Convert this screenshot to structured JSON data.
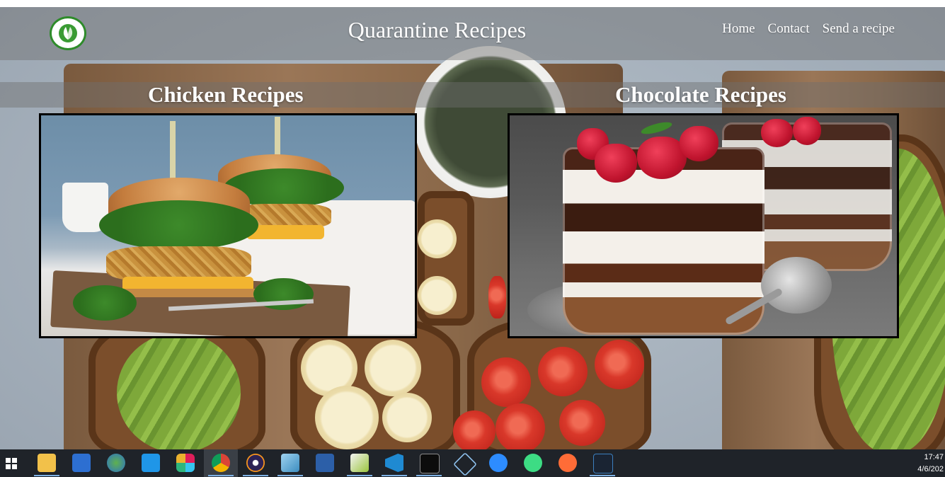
{
  "site": {
    "title": "Quarantine Recipes",
    "nav": [
      "Home",
      "Contact",
      "Send a recipe"
    ]
  },
  "sections": [
    {
      "title": "Chicken Recipes"
    },
    {
      "title": "Chocolate Recipes"
    }
  ],
  "taskbar": {
    "apps": [
      "windows-start-icon",
      "file-explorer-icon",
      "security-app-icon",
      "globe-browser-icon",
      "teamviewer-icon",
      "slack-icon",
      "chrome-icon",
      "eclipse-icon",
      "notepad-icon",
      "network-app-icon",
      "spreadsheet-icon",
      "vscode-icon",
      "terminal-icon",
      "box-app-icon",
      "zoom-icon",
      "android-studio-icon",
      "postman-icon",
      "nox-icon"
    ],
    "time": "17:47",
    "date": "4/6/202"
  },
  "colors": {
    "overlay": "#6e6e6e",
    "logo_green": "#2e8b2a",
    "taskbar": "#1f2329"
  }
}
